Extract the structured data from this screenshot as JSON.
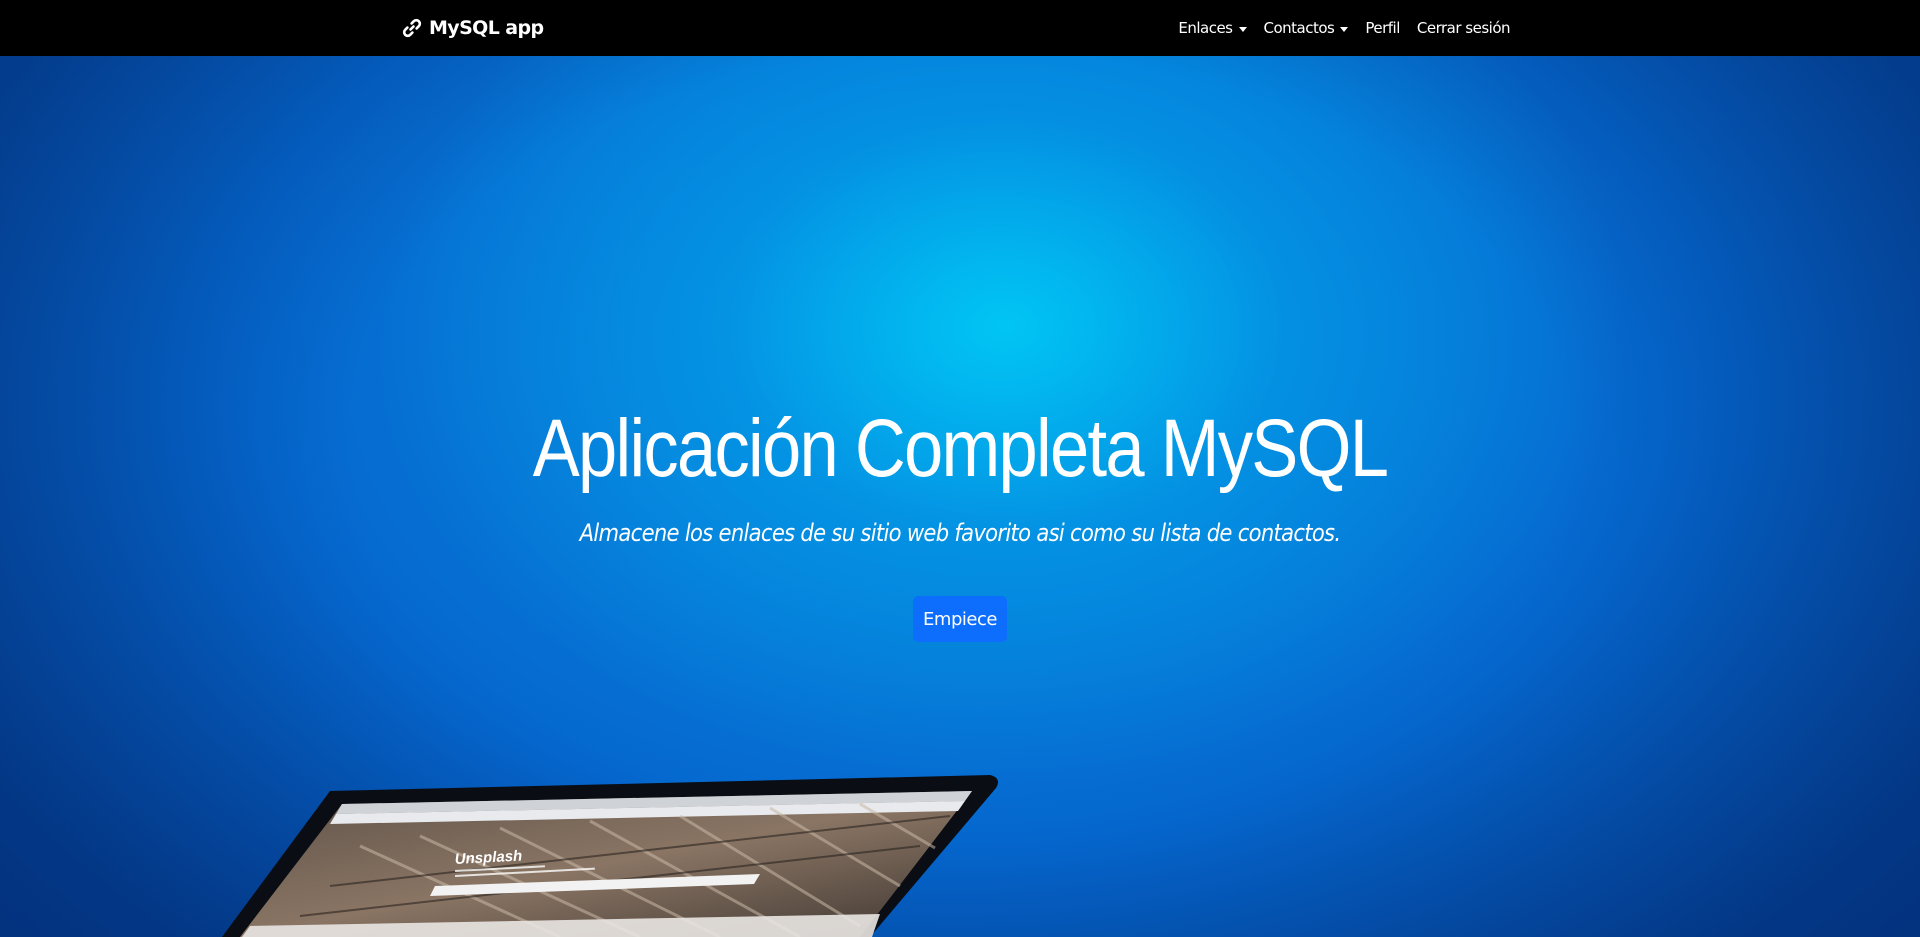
{
  "navbar": {
    "brand_label": "MySQL app",
    "brand_icon": "link-icon",
    "items": [
      {
        "label": "Enlaces",
        "has_dropdown": true
      },
      {
        "label": "Contactos",
        "has_dropdown": true
      },
      {
        "label": "Perfil",
        "has_dropdown": false
      },
      {
        "label": "Cerrar sesión",
        "has_dropdown": false
      }
    ]
  },
  "hero": {
    "title": "Aplicación Completa MySQL",
    "subtitle": "Almacene los enlaces de su sitio web favorito asi como su lista de contactos.",
    "cta_label": "Empiece",
    "laptop_screen_text": "Unsplash"
  },
  "colors": {
    "navbar_bg": "#000000",
    "hero_glow": "#00c4f5",
    "hero_base": "#0567cf",
    "cta_bg": "#0d6efd",
    "text": "#ffffff"
  }
}
